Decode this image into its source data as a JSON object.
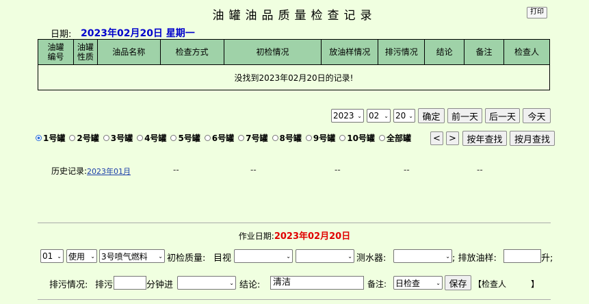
{
  "title": "油罐油品质量检查记录",
  "print_label": "打印",
  "date_label": "日期:",
  "date_value": "2023年02月20日 星期一",
  "table": {
    "headers": [
      "油罐\n编号",
      "油罐\n性质",
      "油品名称",
      "检查方式",
      "初检情况",
      "放油样情况",
      "排污情况",
      "结论",
      "备注",
      "检查人"
    ],
    "empty_message": "没找到2023年02月20日的记录!"
  },
  "nav": {
    "year": "2023",
    "month": "02",
    "day": "20",
    "confirm": "确定",
    "prev_day": "前一天",
    "next_day": "后一天",
    "today": "今天"
  },
  "tanks": {
    "items": [
      "1号罐",
      "2号罐",
      "3号罐",
      "4号罐",
      "5号罐",
      "6号罐",
      "7号罐",
      "8号罐",
      "9号罐",
      "10号罐",
      "全部罐"
    ],
    "selected": "1号罐",
    "prev": "<",
    "next": ">",
    "by_year": "按年查找",
    "by_month": "按月查找"
  },
  "history": {
    "label": "历史记录:",
    "link": "2023年01月",
    "dashes": [
      "--",
      "--",
      "--",
      "--",
      "--"
    ]
  },
  "work": {
    "date_label": "作业日期:",
    "date_value": "2023年02月20日"
  },
  "form": {
    "tank_no": "01",
    "usage": "使用",
    "product": "3号喷气燃料",
    "initial_quality_label": "初检质量:",
    "visual_label": "目视",
    "visual_1": "",
    "visual_2": "",
    "water_meter_label": "测水器:",
    "water_meter": "",
    "sample_label": "; 排放油样:",
    "sample_value": "",
    "sample_unit": "升;",
    "drain_label": "排污情况:",
    "drain_prefix": "排污",
    "drain_minutes": "",
    "drain_unit": "分钟进",
    "drain_select": "",
    "conclusion_label": "结论:",
    "conclusion_value": "清洁",
    "remark_label": "备注:",
    "remark_value": "日检查",
    "save": "保存",
    "inspector_label": "【检查人",
    "inspector_value": "",
    "inspector_close": "】"
  }
}
